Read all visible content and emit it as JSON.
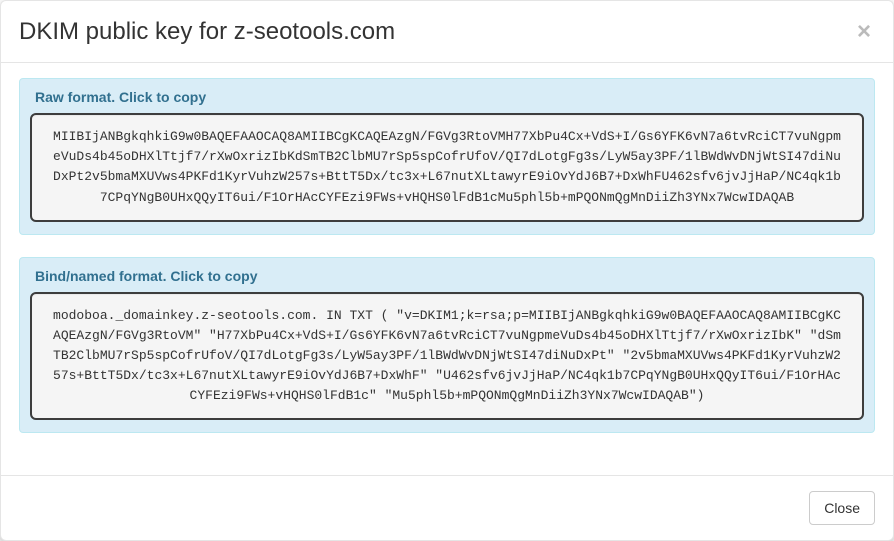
{
  "header": {
    "title": "DKIM public key for z-seotools.com",
    "close_glyph": "×"
  },
  "panels": {
    "raw": {
      "title": "Raw format. Click to copy",
      "content": "MIIBIjANBgkqhkiG9w0BAQEFAAOCAQ8AMIIBCgKCAQEAzgN/FGVg3RtoVMH77XbPu4Cx+VdS+I/Gs6YFK6vN7a6tvRciCT7vuNgpmeVuDs4b45oDHXlTtjf7/rXwOxrizIbKdSmTB2ClbMU7rSp5spCofrUfoV/QI7dLotgFg3s/LyW5ay3PF/1lBWdWvDNjWtSI47diNuDxPt2v5bmaMXUVws4PKFd1KyrVuhzW257s+BttT5Dx/tc3x+L67nutXLtawyrE9iOvYdJ6B7+DxWhFU462sfv6jvJjHaP/NC4qk1b7CPqYNgB0UHxQQyIT6ui/F1OrHAcCYFEzi9FWs+vHQHS0lFdB1cMu5phl5b+mPQONmQgMnDiiZh3YNx7WcwIDAQAB"
    },
    "bind": {
      "title": "Bind/named format. Click to copy",
      "content": "modoboa._domainkey.z-seotools.com. IN TXT ( \"v=DKIM1;k=rsa;p=MIIBIjANBgkqhkiG9w0BAQEFAAOCAQ8AMIIBCgKCAQEAzgN/FGVg3RtoVM\" \"H77XbPu4Cx+VdS+I/Gs6YFK6vN7a6tvRciCT7vuNgpmeVuDs4b45oDHXlTtjf7/rXwOxrizIbK\" \"dSmTB2ClbMU7rSp5spCofrUfoV/QI7dLotgFg3s/LyW5ay3PF/1lBWdWvDNjWtSI47diNuDxPt\" \"2v5bmaMXUVws4PKFd1KyrVuhzW257s+BttT5Dx/tc3x+L67nutXLtawyrE9iOvYdJ6B7+DxWhF\" \"U462sfv6jvJjHaP/NC4qk1b7CPqYNgB0UHxQQyIT6ui/F1OrHAcCYFEzi9FWs+vHQHS0lFdB1c\" \"Mu5phl5b+mPQONmQgMnDiiZh3YNx7WcwIDAQAB\")"
    }
  },
  "footer": {
    "close_label": "Close"
  }
}
